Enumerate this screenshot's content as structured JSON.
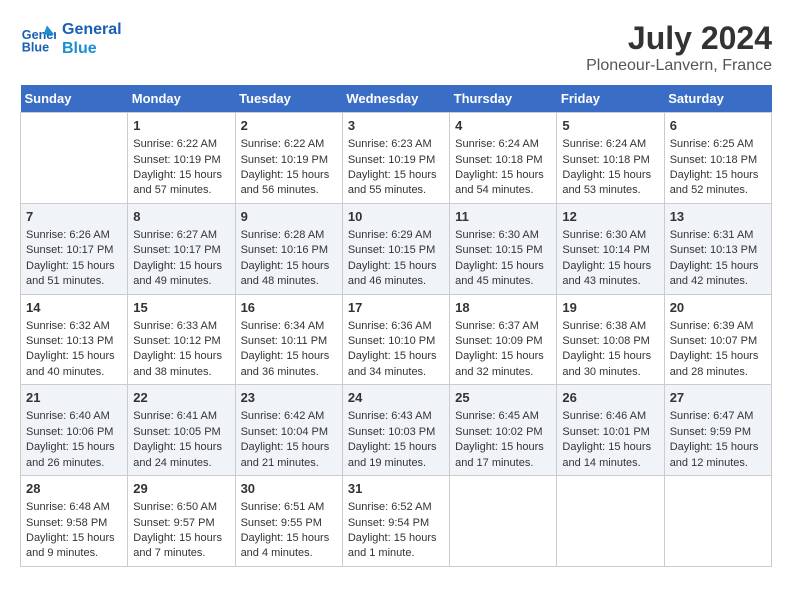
{
  "header": {
    "logo_line1": "General",
    "logo_line2": "Blue",
    "month_year": "July 2024",
    "location": "Ploneour-Lanvern, France"
  },
  "weekdays": [
    "Sunday",
    "Monday",
    "Tuesday",
    "Wednesday",
    "Thursday",
    "Friday",
    "Saturday"
  ],
  "weeks": [
    [
      {
        "day": "",
        "content": ""
      },
      {
        "day": "1",
        "content": "Sunrise: 6:22 AM\nSunset: 10:19 PM\nDaylight: 15 hours and 57 minutes."
      },
      {
        "day": "2",
        "content": "Sunrise: 6:22 AM\nSunset: 10:19 PM\nDaylight: 15 hours and 56 minutes."
      },
      {
        "day": "3",
        "content": "Sunrise: 6:23 AM\nSunset: 10:19 PM\nDaylight: 15 hours and 55 minutes."
      },
      {
        "day": "4",
        "content": "Sunrise: 6:24 AM\nSunset: 10:18 PM\nDaylight: 15 hours and 54 minutes."
      },
      {
        "day": "5",
        "content": "Sunrise: 6:24 AM\nSunset: 10:18 PM\nDaylight: 15 hours and 53 minutes."
      },
      {
        "day": "6",
        "content": "Sunrise: 6:25 AM\nSunset: 10:18 PM\nDaylight: 15 hours and 52 minutes."
      }
    ],
    [
      {
        "day": "7",
        "content": "Sunrise: 6:26 AM\nSunset: 10:17 PM\nDaylight: 15 hours and 51 minutes."
      },
      {
        "day": "8",
        "content": "Sunrise: 6:27 AM\nSunset: 10:17 PM\nDaylight: 15 hours and 49 minutes."
      },
      {
        "day": "9",
        "content": "Sunrise: 6:28 AM\nSunset: 10:16 PM\nDaylight: 15 hours and 48 minutes."
      },
      {
        "day": "10",
        "content": "Sunrise: 6:29 AM\nSunset: 10:15 PM\nDaylight: 15 hours and 46 minutes."
      },
      {
        "day": "11",
        "content": "Sunrise: 6:30 AM\nSunset: 10:15 PM\nDaylight: 15 hours and 45 minutes."
      },
      {
        "day": "12",
        "content": "Sunrise: 6:30 AM\nSunset: 10:14 PM\nDaylight: 15 hours and 43 minutes."
      },
      {
        "day": "13",
        "content": "Sunrise: 6:31 AM\nSunset: 10:13 PM\nDaylight: 15 hours and 42 minutes."
      }
    ],
    [
      {
        "day": "14",
        "content": "Sunrise: 6:32 AM\nSunset: 10:13 PM\nDaylight: 15 hours and 40 minutes."
      },
      {
        "day": "15",
        "content": "Sunrise: 6:33 AM\nSunset: 10:12 PM\nDaylight: 15 hours and 38 minutes."
      },
      {
        "day": "16",
        "content": "Sunrise: 6:34 AM\nSunset: 10:11 PM\nDaylight: 15 hours and 36 minutes."
      },
      {
        "day": "17",
        "content": "Sunrise: 6:36 AM\nSunset: 10:10 PM\nDaylight: 15 hours and 34 minutes."
      },
      {
        "day": "18",
        "content": "Sunrise: 6:37 AM\nSunset: 10:09 PM\nDaylight: 15 hours and 32 minutes."
      },
      {
        "day": "19",
        "content": "Sunrise: 6:38 AM\nSunset: 10:08 PM\nDaylight: 15 hours and 30 minutes."
      },
      {
        "day": "20",
        "content": "Sunrise: 6:39 AM\nSunset: 10:07 PM\nDaylight: 15 hours and 28 minutes."
      }
    ],
    [
      {
        "day": "21",
        "content": "Sunrise: 6:40 AM\nSunset: 10:06 PM\nDaylight: 15 hours and 26 minutes."
      },
      {
        "day": "22",
        "content": "Sunrise: 6:41 AM\nSunset: 10:05 PM\nDaylight: 15 hours and 24 minutes."
      },
      {
        "day": "23",
        "content": "Sunrise: 6:42 AM\nSunset: 10:04 PM\nDaylight: 15 hours and 21 minutes."
      },
      {
        "day": "24",
        "content": "Sunrise: 6:43 AM\nSunset: 10:03 PM\nDaylight: 15 hours and 19 minutes."
      },
      {
        "day": "25",
        "content": "Sunrise: 6:45 AM\nSunset: 10:02 PM\nDaylight: 15 hours and 17 minutes."
      },
      {
        "day": "26",
        "content": "Sunrise: 6:46 AM\nSunset: 10:01 PM\nDaylight: 15 hours and 14 minutes."
      },
      {
        "day": "27",
        "content": "Sunrise: 6:47 AM\nSunset: 9:59 PM\nDaylight: 15 hours and 12 minutes."
      }
    ],
    [
      {
        "day": "28",
        "content": "Sunrise: 6:48 AM\nSunset: 9:58 PM\nDaylight: 15 hours and 9 minutes."
      },
      {
        "day": "29",
        "content": "Sunrise: 6:50 AM\nSunset: 9:57 PM\nDaylight: 15 hours and 7 minutes."
      },
      {
        "day": "30",
        "content": "Sunrise: 6:51 AM\nSunset: 9:55 PM\nDaylight: 15 hours and 4 minutes."
      },
      {
        "day": "31",
        "content": "Sunrise: 6:52 AM\nSunset: 9:54 PM\nDaylight: 15 hours and 1 minute."
      },
      {
        "day": "",
        "content": ""
      },
      {
        "day": "",
        "content": ""
      },
      {
        "day": "",
        "content": ""
      }
    ]
  ]
}
